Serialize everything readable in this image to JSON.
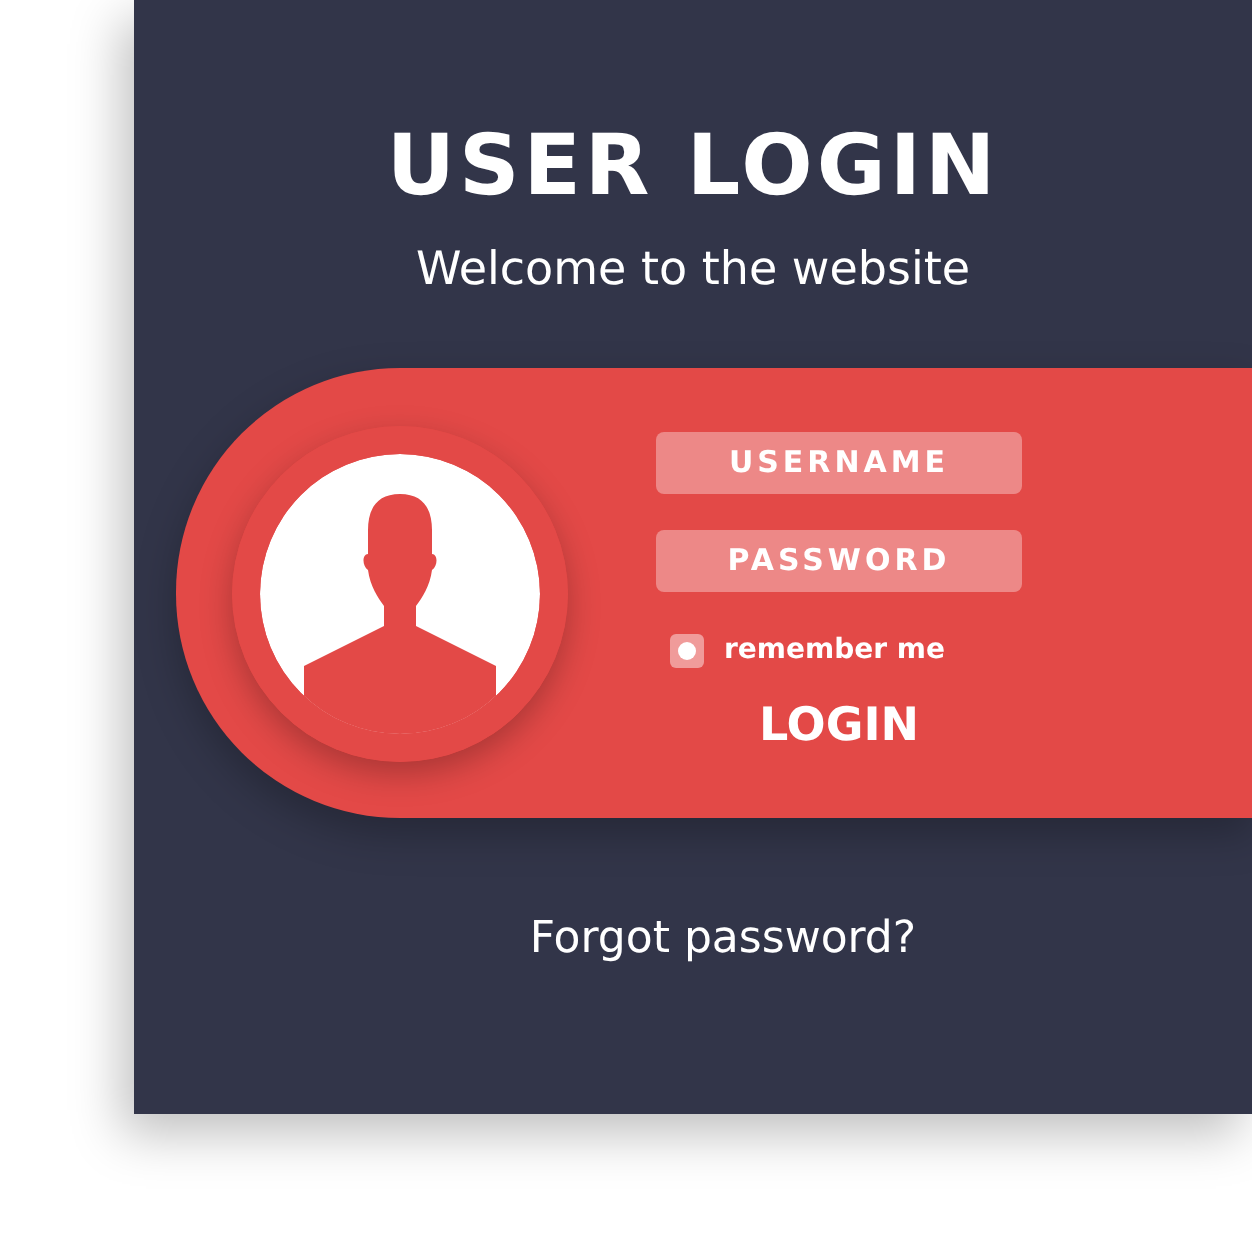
{
  "title": "USER LOGIN",
  "subtitle": "Welcome to the website",
  "form": {
    "username": {
      "placeholder": "USERNAME"
    },
    "password": {
      "placeholder": "PASSWORD"
    },
    "remember": {
      "label": "remember me",
      "checked": true
    },
    "login_button": "LOGIN"
  },
  "forgot_link": "Forgot password?"
}
